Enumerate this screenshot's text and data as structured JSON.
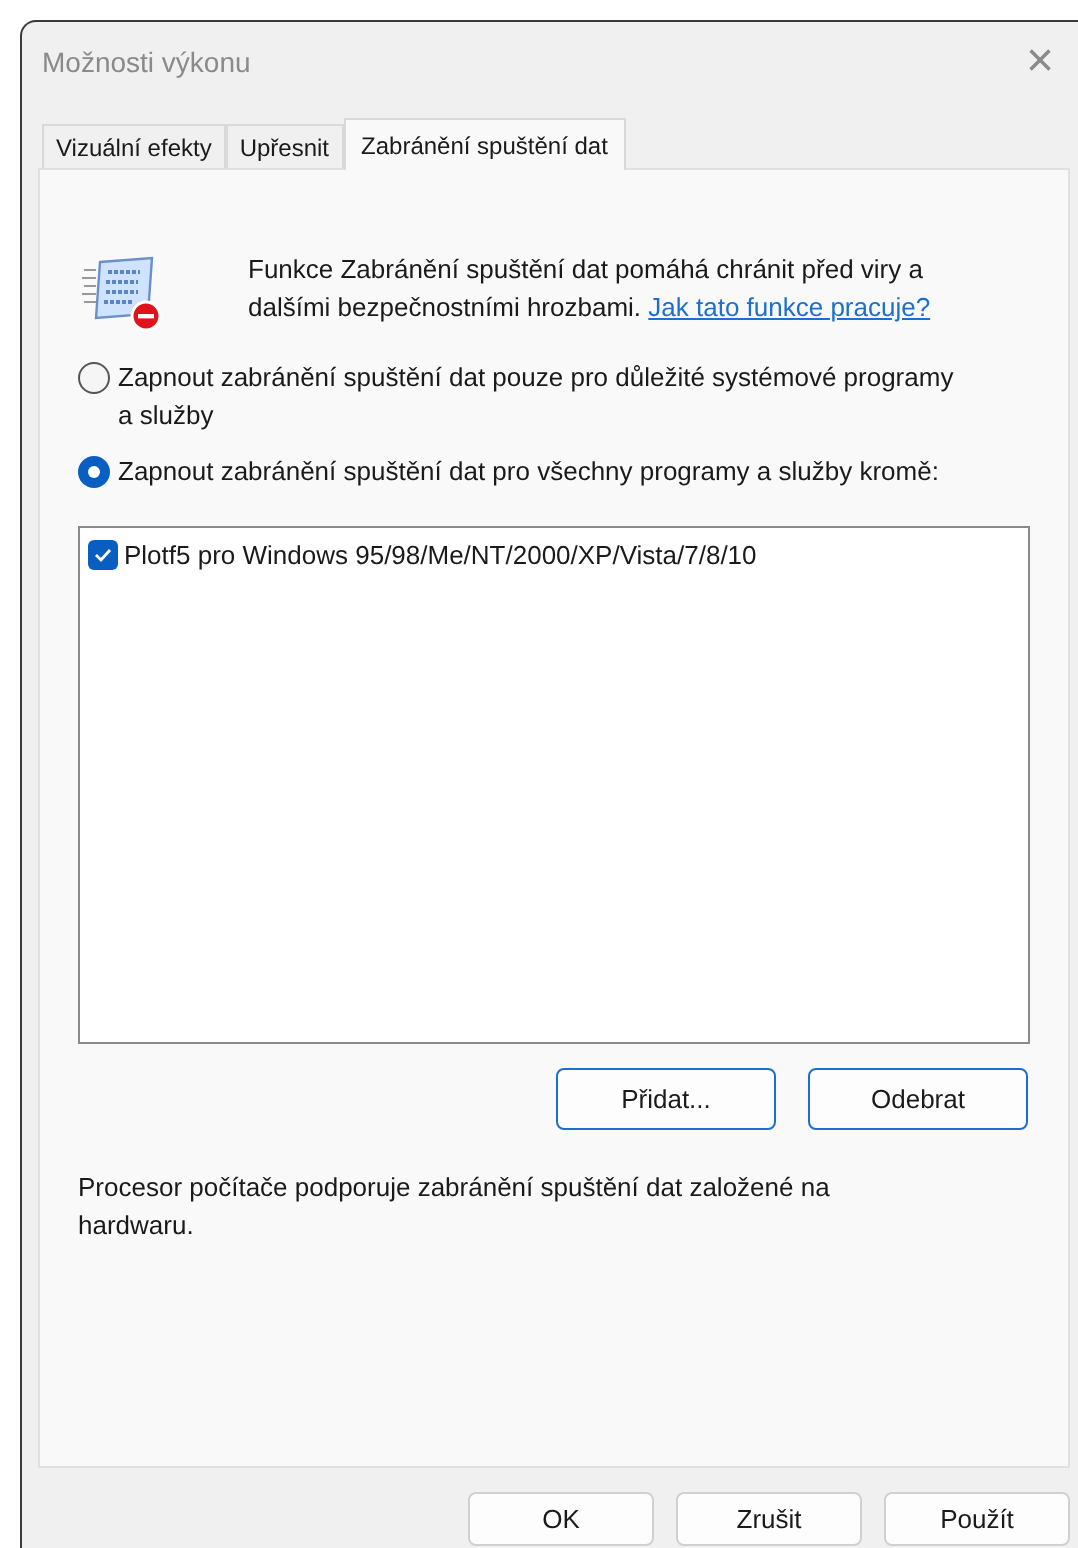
{
  "window": {
    "title": "Možnosti výkonu",
    "close": "×"
  },
  "tabs": [
    {
      "label": "Vizuální efekty",
      "selected": false
    },
    {
      "label": "Upřesnit",
      "selected": false
    },
    {
      "label": "Zabránění spuštění dat",
      "selected": true
    }
  ],
  "description": {
    "text": "Funkce Zabránění spuštění dat pomáhá chránit před viry a dalšími bezpečnostními hrozbami.",
    "link": "Jak tato funkce pracuje?"
  },
  "options": [
    {
      "label": "Zapnout zabránění spuštění dat pouze pro důležité systémové programy a služby",
      "selected": false
    },
    {
      "label": "Zapnout zabránění spuštění dat pro všechny programy a služby kromě:",
      "selected": true
    }
  ],
  "exceptions": [
    {
      "label": "Plotf5 pro Windows 95/98/Me/NT/2000/XP/Vista/7/8/10",
      "checked": true
    }
  ],
  "list_buttons": [
    "Přidat...",
    "Odebrat"
  ],
  "status": "Procesor počítače podporuje zabránění spuštění dat založené na hardwaru.",
  "buttons": [
    "OK",
    "Zrušit",
    "Použít"
  ]
}
